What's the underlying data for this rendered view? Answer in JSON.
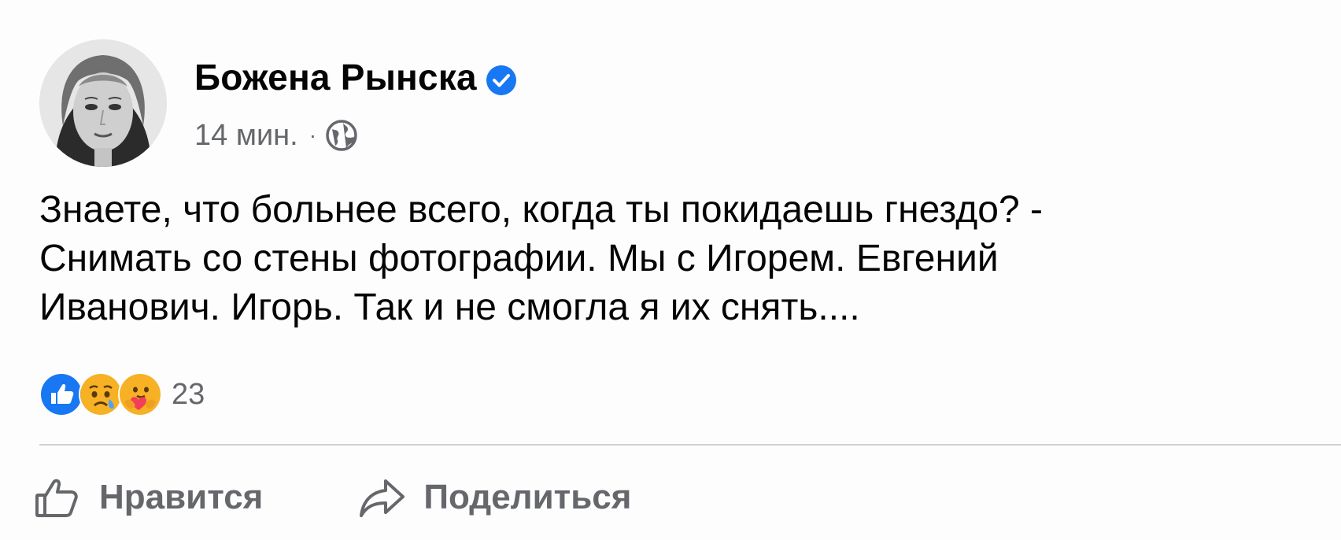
{
  "post": {
    "author": "Божена Рынска",
    "time": "14 мин.",
    "separator": "·",
    "text_lines": [
      "Знаете, что больнее всего, когда ты покидаешь гнездо? -",
      "Снимать со стены фотографии. Мы с Игорем. Евгений",
      "Иванович. Игорь. Так и не смогла я их снять...."
    ],
    "reactions": {
      "icons": [
        "like-icon",
        "sad-icon",
        "care-icon"
      ],
      "count": "23"
    },
    "actions": {
      "like_label": "Нравится",
      "share_label": "Поделиться"
    }
  },
  "colors": {
    "verified_blue": "#1877f2",
    "secondary_text": "#65676b",
    "divider": "#ced0d4"
  }
}
